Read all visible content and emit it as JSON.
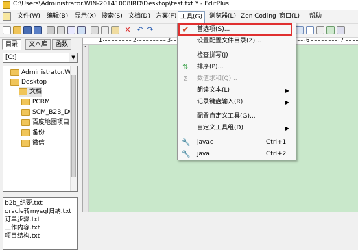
{
  "window": {
    "title": "C:\\Users\\Administrator.WIN-20141008IRD\\Desktop\\test.txt * - EditPlus"
  },
  "menubar": {
    "items": [
      {
        "label": "文件(W)"
      },
      {
        "label": "编辑(B)"
      },
      {
        "label": "显示(X)"
      },
      {
        "label": "搜索(S)"
      },
      {
        "label": "文档(D)"
      },
      {
        "label": "方案(F)"
      },
      {
        "label": "工具(G)"
      },
      {
        "label": "浏览器(L)"
      },
      {
        "label": "Zen Coding"
      },
      {
        "label": "窗口(L)"
      },
      {
        "label": "帮助"
      }
    ]
  },
  "toolbar": {
    "icons": [
      "new-file-icon",
      "open-icon",
      "save-icon",
      "save-all-icon",
      "print-icon",
      "print-preview-icon",
      "spell-check-icon",
      "find-icon",
      "cut-icon",
      "copy-icon",
      "paste-icon",
      "delete-icon",
      "undo-icon",
      "redo-icon"
    ],
    "right_icons": [
      "view-icon",
      "wordwrap-icon",
      "ruler-icon",
      "browser-icon",
      "fullscreen-icon"
    ]
  },
  "sidebar": {
    "tabs": [
      {
        "label": "目录"
      },
      {
        "label": "文本库"
      },
      {
        "label": "函数"
      }
    ],
    "drive": "[C:]",
    "tree": [
      {
        "label": "Administrator.W"
      },
      {
        "label": "Desktop"
      },
      {
        "label": "文档"
      },
      {
        "label": "PCRM"
      },
      {
        "label": "SCM_B2B_DC"
      },
      {
        "label": "百度地图项目"
      },
      {
        "label": "备份"
      },
      {
        "label": "微信"
      }
    ],
    "files": [
      {
        "label": "b2b_纪要.txt"
      },
      {
        "label": "oracle转mysql归纳.txt"
      },
      {
        "label": "订单步骤.txt"
      },
      {
        "label": "工作内容.txt"
      },
      {
        "label": "项目结构.txt"
      }
    ]
  },
  "editor": {
    "line_number": "1",
    "ruler_marks": [
      "1",
      "2",
      "3",
      "4",
      "5",
      "6",
      "7"
    ]
  },
  "tools_menu": {
    "items": [
      {
        "label": "首选项(S)...",
        "icon": "checkmark-icon"
      },
      {
        "label": "设置配置文件目录(Z)..."
      },
      {
        "label": "检查拼写(J)"
      },
      {
        "label": "排序(P)..."
      },
      {
        "label": "数值求和(Q)..."
      },
      {
        "label": "朗读文本(L)"
      },
      {
        "label": "记录键盘输入(R)"
      },
      {
        "label": "配置自定义工具(G)..."
      },
      {
        "label": "自定义工具组(D)"
      },
      {
        "label": "javac",
        "shortcut": "Ctrl+1"
      },
      {
        "label": "java",
        "shortcut": "Ctrl+2"
      }
    ]
  },
  "colors": {
    "editor_bg": "#c9e8cb",
    "highlight_border": "#e03030",
    "folder": "#f0c55a"
  }
}
